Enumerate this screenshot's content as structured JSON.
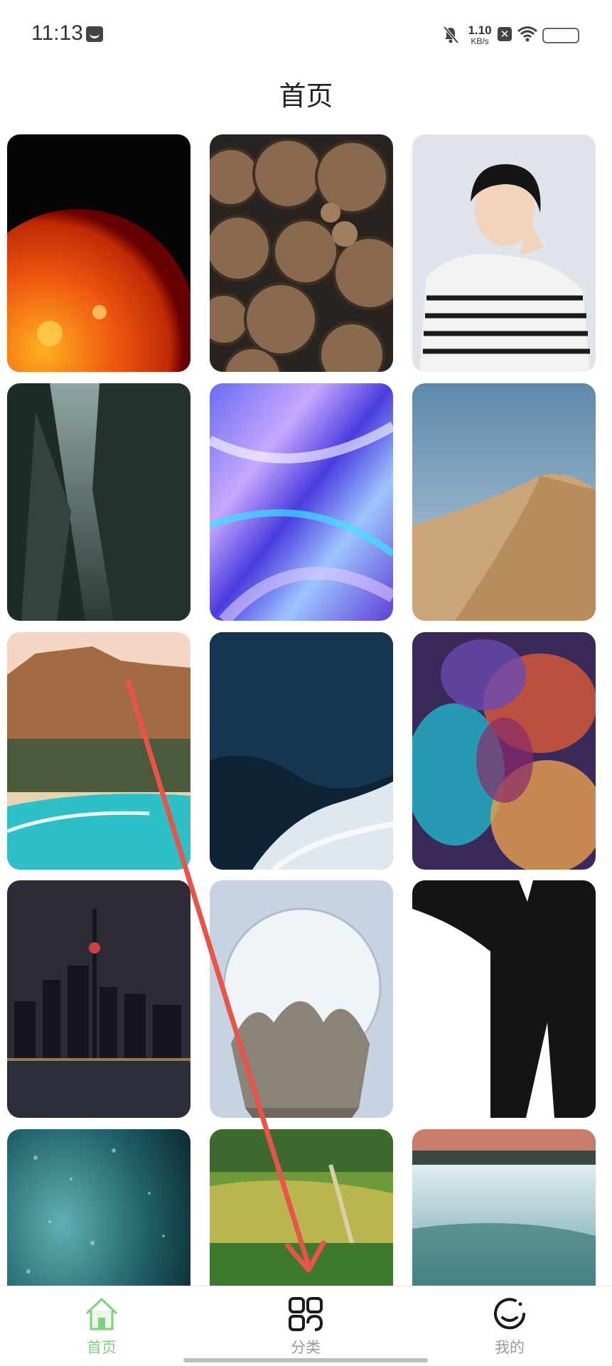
{
  "status_bar": {
    "time": "11:13",
    "net_speed_value": "1.10",
    "net_speed_unit": "KB/s",
    "icons": [
      "message-icon",
      "bell-muted-icon",
      "x-icon",
      "wifi-icon",
      "battery-icon"
    ]
  },
  "header": {
    "title": "首页"
  },
  "grid": {
    "images": [
      "sun",
      "wood-logs",
      "young-man-striped-sweater",
      "misty-forest",
      "holographic-abstract",
      "sand-dune",
      "mountain-coastline",
      "ocean-waves",
      "colorful-nebula",
      "city-skyline-night",
      "glass-sphere-sculpture",
      "man-in-suit-silhouette",
      "rain-drops-teal",
      "green-fields-road",
      "waterfall"
    ]
  },
  "bottom_nav": {
    "items": [
      {
        "label": "首页",
        "icon": "home-icon",
        "active": true,
        "color": "#7ed07e"
      },
      {
        "label": "分类",
        "icon": "grid-category-icon",
        "active": false,
        "color": "#9a9a9a"
      },
      {
        "label": "我的",
        "icon": "profile-smile-icon",
        "active": false,
        "color": "#9a9a9a"
      }
    ]
  },
  "colors": {
    "accent": "#7ed07e",
    "annotation_arrow": "#e8534a"
  }
}
